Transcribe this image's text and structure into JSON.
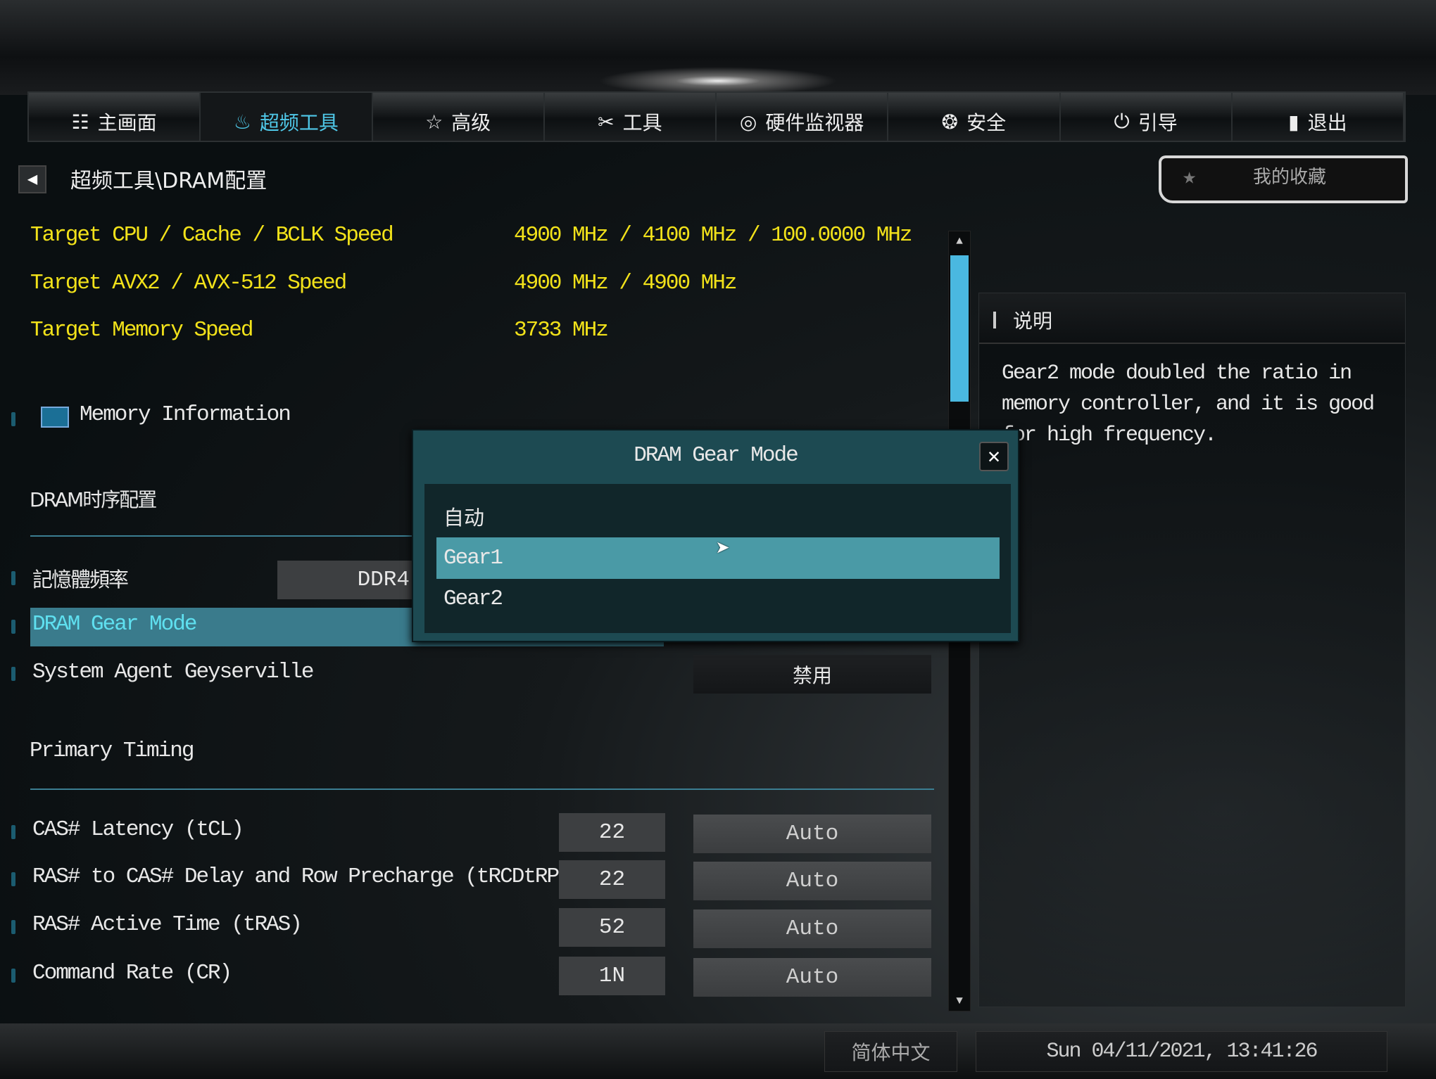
{
  "tabs": [
    {
      "icon": "list-icon",
      "glyph": "☷",
      "label": "主画面"
    },
    {
      "icon": "rocket-icon",
      "glyph": "♨",
      "label": "超频工具",
      "active": true
    },
    {
      "icon": "star-icon",
      "glyph": "☆",
      "label": "高级"
    },
    {
      "icon": "tools-icon",
      "glyph": "✂",
      "label": "工具"
    },
    {
      "icon": "monitor-icon",
      "glyph": "◎",
      "label": "硬件监视器"
    },
    {
      "icon": "shield-icon",
      "glyph": "❂",
      "label": "安全"
    },
    {
      "icon": "power-icon",
      "glyph": "⏻",
      "label": "引导"
    },
    {
      "icon": "exit-icon",
      "glyph": "▮",
      "label": "退出"
    }
  ],
  "breadcrumb": "超频工具\\DRAM配置",
  "favorites": "我的收藏",
  "targets": [
    {
      "label": "Target CPU / Cache / BCLK Speed",
      "value": "4900 MHz / 4100 MHz / 100.0000 MHz"
    },
    {
      "label": "Target AVX2 / AVX-512 Speed",
      "value": "4900 MHz / 4900 MHz"
    },
    {
      "label": "Target Memory Speed",
      "value": "3733 MHz"
    }
  ],
  "memory_info": "Memory Information",
  "section1": "DRAM时序配置",
  "mem_freq": {
    "label": "記憶體頻率",
    "value": "DDR4"
  },
  "gear_mode": {
    "label": "DRAM Gear Mode"
  },
  "geyserville": {
    "label": "System Agent Geyserville",
    "value": "禁用"
  },
  "section2": "Primary Timing",
  "timings": [
    {
      "label": "CAS# Latency (tCL)",
      "value": "22",
      "setting": "Auto"
    },
    {
      "label": "RAS# to CAS# Delay and Row Precharge (tRCDtRP)",
      "value": "22",
      "setting": "Auto"
    },
    {
      "label": "RAS# Active Time (tRAS)",
      "value": "52",
      "setting": "Auto"
    },
    {
      "label": "Command Rate (CR)",
      "value": "1N",
      "setting": "Auto"
    }
  ],
  "help": {
    "title": "说明",
    "lines": [
      "Gear2 mode doubled the ratio in",
      "memory controller, and it is good",
      "for high frequency."
    ]
  },
  "dialog": {
    "title": "DRAM Gear Mode",
    "options": [
      "自动",
      "Gear1",
      "Gear2"
    ],
    "selected": "Gear1"
  },
  "footer": {
    "language": "简体中文",
    "datetime": "Sun 04/11/2021, 13:41:26"
  },
  "colors": {
    "accent": "#4fc8e8",
    "target_text": "#f2e21a",
    "highlight": "#4a9aa6",
    "scroll_thumb": "#4ab8e0"
  }
}
